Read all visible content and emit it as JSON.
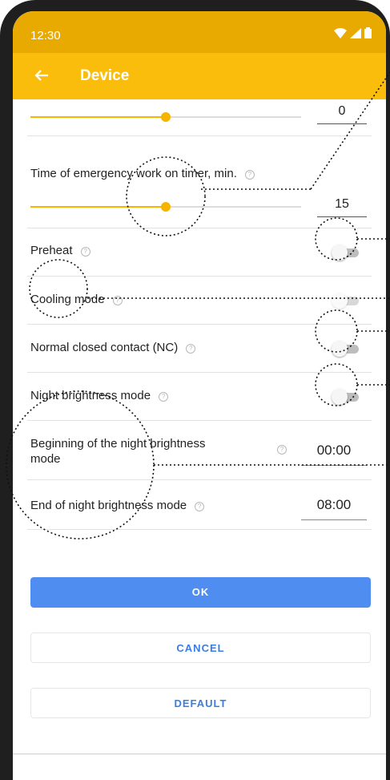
{
  "status_bar": {
    "time": "12:30"
  },
  "app_bar": {
    "title": "Device",
    "back_icon": "arrow-left-icon"
  },
  "settings": {
    "slider_top": {
      "value": "0",
      "fill_fraction": 0.5
    },
    "emergency_timer": {
      "label": "Time of emergency work on timer, min.",
      "value": "15",
      "fill_fraction": 0.5
    },
    "preheat": {
      "label": "Preheat",
      "enabled": false
    },
    "cooling_mode": {
      "label": "Cooling mode",
      "enabled": false,
      "disabled": true
    },
    "nc_contact": {
      "label": "Normal closed contact (NC)",
      "enabled": false
    },
    "night_brightness": {
      "label": "Night brightness mode",
      "enabled": false
    },
    "night_begin": {
      "label_line1": "Beginning of the night brightness",
      "label_line2": "mode",
      "value": "00:00"
    },
    "night_end": {
      "label": "End of night brightness mode",
      "value": "08:00"
    }
  },
  "buttons": {
    "ok": "OK",
    "cancel": "CANCEL",
    "default": "DEFAULT"
  },
  "help_glyph": "?",
  "colors": {
    "accent": "#fbbd0b",
    "status_bar": "#e8aa00",
    "primary_button": "#4f8ef0",
    "link": "#3b7de0"
  }
}
